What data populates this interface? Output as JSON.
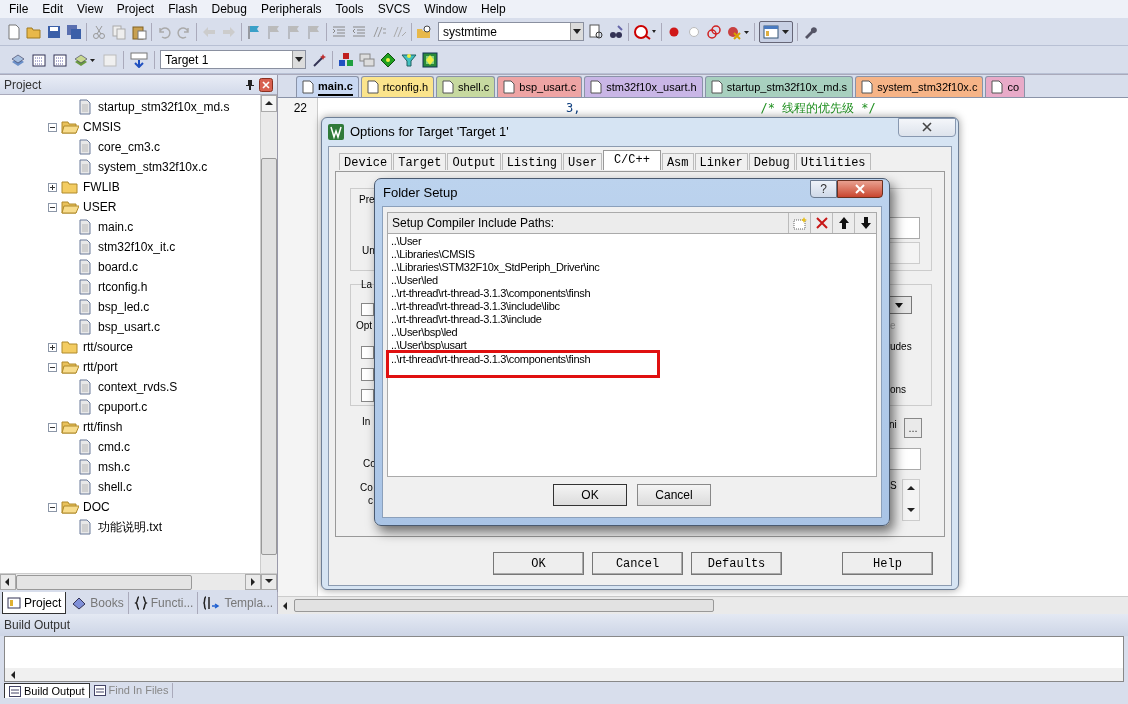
{
  "menu": [
    "File",
    "Edit",
    "View",
    "Project",
    "Flash",
    "Debug",
    "Peripherals",
    "Tools",
    "SVCS",
    "Window",
    "Help"
  ],
  "toolbar": {
    "search_combo": {
      "value": "systmtime"
    },
    "target_combo": {
      "value": "Target 1"
    }
  },
  "project_panel": {
    "title": "Project",
    "tree": [
      {
        "kind": "file",
        "name": "startup_stm32f10x_md.s"
      },
      {
        "kind": "folder",
        "name": "CMSIS",
        "expanded": true,
        "children": [
          {
            "kind": "file",
            "name": "core_cm3.c"
          },
          {
            "kind": "file",
            "name": "system_stm32f10x.c"
          }
        ]
      },
      {
        "kind": "folder",
        "name": "FWLIB",
        "expanded": false
      },
      {
        "kind": "folder",
        "name": "USER",
        "expanded": true,
        "children": [
          {
            "kind": "file",
            "name": "main.c"
          },
          {
            "kind": "file",
            "name": "stm32f10x_it.c"
          },
          {
            "kind": "file",
            "name": "board.c"
          },
          {
            "kind": "file",
            "name": "rtconfig.h"
          },
          {
            "kind": "file",
            "name": "bsp_led.c"
          },
          {
            "kind": "file",
            "name": "bsp_usart.c"
          }
        ]
      },
      {
        "kind": "folder",
        "name": "rtt/source",
        "expanded": false
      },
      {
        "kind": "folder",
        "name": "rtt/port",
        "expanded": true,
        "children": [
          {
            "kind": "file",
            "name": "context_rvds.S"
          },
          {
            "kind": "file",
            "name": "cpuport.c"
          }
        ]
      },
      {
        "kind": "folder",
        "name": "rtt/finsh",
        "expanded": true,
        "children": [
          {
            "kind": "file",
            "name": "cmd.c"
          },
          {
            "kind": "file",
            "name": "msh.c"
          },
          {
            "kind": "file",
            "name": "shell.c"
          }
        ]
      },
      {
        "kind": "folder",
        "name": "DOC",
        "expanded": true,
        "children": [
          {
            "kind": "file",
            "name": "功能说明.txt"
          }
        ]
      }
    ],
    "tabs": [
      {
        "label": "Project",
        "selected": true
      },
      {
        "label": "Books",
        "selected": false
      },
      {
        "label": "Functi...",
        "selected": false
      },
      {
        "label": "Templa...",
        "selected": false
      }
    ]
  },
  "editor": {
    "tabs": [
      {
        "label": "main.c",
        "selected": true,
        "color": "#c9d8f2"
      },
      {
        "label": "rtconfig.h",
        "selected": false,
        "color": "#fbe48c"
      },
      {
        "label": "shell.c",
        "selected": false,
        "color": "#c7d9a0"
      },
      {
        "label": "bsp_usart.c",
        "selected": false,
        "color": "#eea4a4"
      },
      {
        "label": "stm32f10x_usart.h",
        "selected": false,
        "color": "#c9b6e6"
      },
      {
        "label": "startup_stm32f10x_md.s",
        "selected": false,
        "color": "#a8d0bf"
      },
      {
        "label": "system_stm32f10x.c",
        "selected": false,
        "color": "#f6b487"
      },
      {
        "label": "co",
        "selected": false,
        "color": "#e8aac8"
      }
    ],
    "lines": [
      {
        "number": "22",
        "code": "3,",
        "comment": "/* 线程的优先级 */"
      }
    ]
  },
  "options_dialog": {
    "title": "Options for Target 'Target 1'",
    "tabs": [
      {
        "label": "Device",
        "selected": false
      },
      {
        "label": "Target",
        "selected": false
      },
      {
        "label": "Output",
        "selected": false
      },
      {
        "label": "Listing",
        "selected": false
      },
      {
        "label": "User",
        "selected": false
      },
      {
        "label": "C/C++",
        "selected": true
      },
      {
        "label": "Asm",
        "selected": false
      },
      {
        "label": "Linker",
        "selected": false
      },
      {
        "label": "Debug",
        "selected": false
      },
      {
        "label": "Utilities",
        "selected": false
      }
    ],
    "partial_labels": [
      "Pre",
      "Un",
      "La",
      "Opt",
      "e",
      "udes",
      "ons",
      "In",
      "ni",
      "Co",
      "Co",
      "S",
      "c"
    ],
    "checkboxes": [
      {
        "checked": false
      },
      {
        "checked": false
      },
      {
        "checked": false
      },
      {
        "checked": false
      }
    ],
    "buttons": [
      "OK",
      "Cancel",
      "Defaults",
      "Help"
    ],
    "browse_button": "..."
  },
  "folder_dialog": {
    "title": "Folder Setup",
    "help_button": "?",
    "list_title": "Setup Compiler Include Paths:",
    "paths": [
      {
        "path": "..\\User",
        "highlighted": false
      },
      {
        "path": "..\\Libraries\\CMSIS",
        "highlighted": false
      },
      {
        "path": "..\\Libraries\\STM32F10x_StdPeriph_Driver\\inc",
        "highlighted": false
      },
      {
        "path": "..\\User\\led",
        "highlighted": false
      },
      {
        "path": "..\\rt-thread\\rt-thread-3.1.3\\components\\finsh",
        "highlighted": false
      },
      {
        "path": "..\\rt-thread\\rt-thread-3.1.3\\include\\libc",
        "highlighted": false
      },
      {
        "path": "..\\rt-thread\\rt-thread-3.1.3\\include",
        "highlighted": false
      },
      {
        "path": "..\\User\\bsp\\led",
        "highlighted": false
      },
      {
        "path": "..\\User\\bsp\\usart",
        "highlighted": false
      },
      {
        "path": "..\\rt-thread\\rt-thread-3.1.3\\components\\finsh",
        "highlighted": true
      }
    ],
    "buttons": [
      "OK",
      "Cancel"
    ]
  },
  "build_output": {
    "title": "Build Output",
    "tabs": [
      {
        "label": "Build Output",
        "selected": true
      },
      {
        "label": "Find In Files",
        "selected": false
      }
    ]
  }
}
